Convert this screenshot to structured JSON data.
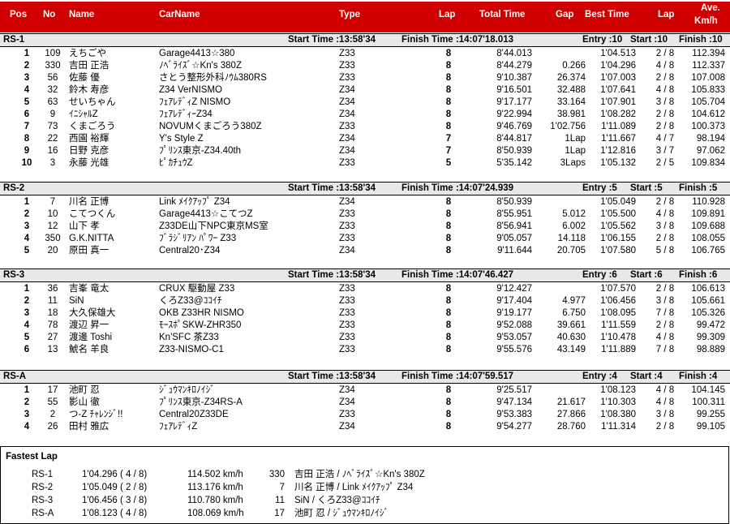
{
  "header": {
    "pos": "Pos",
    "no": "No",
    "name": "Name",
    "carname": "CarName",
    "type": "Type",
    "lap": "Lap",
    "total_time": "Total Time",
    "gap": "Gap",
    "best_time": "Best Time",
    "best_lap": "Lap",
    "ave_1": "Ave.",
    "ave_2": "Km/h"
  },
  "classes": [
    {
      "name": "RS-1",
      "start": "Start Time :13:58'34",
      "finish": "Finish Time :14:07'18.013",
      "entry": "Entry :10",
      "started": "Start :10",
      "finished": "Finish :10",
      "rows": [
        [
          "1",
          "109",
          "えちごや",
          "Garage4413☆380",
          "Z33",
          "8",
          "8'44.013",
          "",
          "1'04.513",
          "2 / 8",
          "112.394"
        ],
        [
          "2",
          "330",
          "吉田 正浩",
          "ﾉﾍﾞﾗｲｽﾞ☆Kn's 380Z",
          "Z33",
          "8",
          "8'44.279",
          "0.266",
          "1'04.296",
          "4 / 8",
          "112.337"
        ],
        [
          "3",
          "56",
          "佐藤 優",
          "さとう整形外科ﾉｳﾑ380RS",
          "Z33",
          "8",
          "9'10.387",
          "26.374",
          "1'07.003",
          "2 / 8",
          "107.008"
        ],
        [
          "4",
          "32",
          "鈴木 寿彦",
          "Z34 VerNISMO",
          "Z34",
          "8",
          "9'16.501",
          "32.488",
          "1'07.641",
          "4 / 8",
          "105.833"
        ],
        [
          "5",
          "63",
          "せいちゃん",
          "ﾌｪｱﾚﾃﾞｨZ NISMO",
          "Z34",
          "8",
          "9'17.177",
          "33.164",
          "1'07.901",
          "3 / 8",
          "105.704"
        ],
        [
          "6",
          "9",
          "ｲﾆｼｬﾙZ",
          "ﾌｪｱﾚﾃﾞｨｰZ34",
          "Z34",
          "8",
          "9'22.994",
          "38.981",
          "1'08.282",
          "2 / 8",
          "104.612"
        ],
        [
          "7",
          "73",
          "くまごろう",
          "NOVUMくまごろう380Z",
          "Z33",
          "8",
          "9'46.769",
          "1'02.756",
          "1'11.089",
          "2 / 8",
          "100.373"
        ],
        [
          "8",
          "22",
          "西園 裕輝",
          "Y's Style Z",
          "Z34",
          "7",
          "8'44.817",
          "1Lap",
          "1'11.667",
          "4 / 7",
          "98.194"
        ],
        [
          "9",
          "16",
          "日野 克彦",
          "ﾌﾟﾘﾝｽ東京-Z34.40th",
          "Z34",
          "7",
          "8'50.939",
          "1Lap",
          "1'12.816",
          "3 / 7",
          "97.062"
        ],
        [
          "10",
          "3",
          "永藤 光雄",
          "ﾋﾟｶﾁｭｳZ",
          "Z33",
          "5",
          "5'35.142",
          "3Laps",
          "1'05.132",
          "2 / 5",
          "109.834"
        ]
      ]
    },
    {
      "name": "RS-2",
      "start": "Start Time :13:58'34",
      "finish": "Finish Time :14:07'24.939",
      "entry": "Entry :5",
      "started": "Start :5",
      "finished": "Finish :5",
      "rows": [
        [
          "1",
          "7",
          "川名 正博",
          "Link ﾒｲｸｱｯﾌﾟ Z34",
          "Z34",
          "8",
          "8'50.939",
          "",
          "1'05.049",
          "2 / 8",
          "110.928"
        ],
        [
          "2",
          "10",
          "こてつくん",
          "Garage4413☆こてつZ",
          "Z33",
          "8",
          "8'55.951",
          "5.012",
          "1'05.500",
          "4 / 8",
          "109.891"
        ],
        [
          "3",
          "12",
          "山下 孝",
          "Z33DE山下NPC東京MS室",
          "Z33",
          "8",
          "8'56.941",
          "6.002",
          "1'05.562",
          "3 / 8",
          "109.688"
        ],
        [
          "4",
          "350",
          "G.K.NITTA",
          "ﾌﾞﾗｼﾞﾘｱﾝ ﾊﾟﾜｰ Z33",
          "Z33",
          "8",
          "9'05.057",
          "14.118",
          "1'06.155",
          "2 / 8",
          "108.055"
        ],
        [
          "5",
          "20",
          "原田 真一",
          "Central20･Z34",
          "Z34",
          "8",
          "9'11.644",
          "20.705",
          "1'07.580",
          "5 / 8",
          "106.765"
        ]
      ]
    },
    {
      "name": "RS-3",
      "start": "Start Time :13:58'34",
      "finish": "Finish Time :14:07'46.427",
      "entry": "Entry :6",
      "started": "Start :6",
      "finished": "Finish :6",
      "rows": [
        [
          "1",
          "36",
          "吉峯 竜太",
          "CRUX 駆動屋 Z33",
          "Z33",
          "8",
          "9'12.427",
          "",
          "1'07.570",
          "2 / 8",
          "106.613"
        ],
        [
          "2",
          "11",
          "SiN",
          "くろZ33@ｺｺｲﾁ",
          "Z33",
          "8",
          "9'17.404",
          "4.977",
          "1'06.456",
          "3 / 8",
          "105.661"
        ],
        [
          "3",
          "18",
          "大久保雄大",
          "OKB Z33HR NISMO",
          "Z33",
          "8",
          "9'19.177",
          "6.750",
          "1'08.095",
          "7 / 8",
          "105.326"
        ],
        [
          "4",
          "78",
          "渡辺 昇一",
          "ﾓｰｽﾎﾟSKW-ZHR350",
          "Z33",
          "8",
          "9'52.088",
          "39.661",
          "1'11.559",
          "2 / 8",
          "99.472"
        ],
        [
          "5",
          "27",
          "渡邊 Toshi",
          "Kn'SFC 茶Z33",
          "Z33",
          "8",
          "9'53.057",
          "40.630",
          "1'10.478",
          "4 / 8",
          "99.309"
        ],
        [
          "6",
          "13",
          "鯱名 羊良",
          "Z33-NISMO-C1",
          "Z33",
          "8",
          "9'55.576",
          "43.149",
          "1'11.889",
          "7 / 8",
          "98.889"
        ]
      ]
    },
    {
      "name": "RS-A",
      "start": "Start Time :13:58'34",
      "finish": "Finish Time :14:07'59.517",
      "entry": "Entry :4",
      "started": "Start :4",
      "finished": "Finish :4",
      "rows": [
        [
          "1",
          "17",
          "池町 忍",
          "ｼﾞｭｳﾏﾝｷﾛﾉｲｼﾞ",
          "Z34",
          "8",
          "9'25.517",
          "",
          "1'08.123",
          "4 / 8",
          "104.145"
        ],
        [
          "2",
          "55",
          "影山 徹",
          "ﾌﾟﾘﾝｽ東京-Z34RS-A",
          "Z34",
          "8",
          "9'47.134",
          "21.617",
          "1'10.303",
          "4 / 8",
          "100.311"
        ],
        [
          "3",
          "2",
          "つ-Z ﾁｬﾚﾝｼﾞ!!",
          "Central20Z33DE",
          "Z33",
          "8",
          "9'53.383",
          "27.866",
          "1'08.380",
          "3 / 8",
          "99.255"
        ],
        [
          "4",
          "26",
          "田村 雅広",
          "ﾌｪｱﾚﾃﾞｨZ",
          "Z34",
          "8",
          "9'54.277",
          "28.760",
          "1'11.314",
          "2 / 8",
          "99.105"
        ]
      ]
    }
  ],
  "fastest_lap": {
    "title": "Fastest Lap",
    "rows": [
      [
        "RS-1",
        "1'04.296 ( 4 / 8)",
        "114.502 km/h",
        "330",
        "吉田 正浩 / ﾉﾍﾞﾗｲｽﾞ☆Kn's 380Z"
      ],
      [
        "RS-2",
        "1'05.049 ( 2 / 8)",
        "113.176 km/h",
        "7",
        "川名 正博 / Link ﾒｲｸｱｯﾌﾟ Z34"
      ],
      [
        "RS-3",
        "1'06.456 ( 3 / 8)",
        "110.780 km/h",
        "11",
        "SiN / くろZ33@ｺｺｲﾁ"
      ],
      [
        "RS-A",
        "1'08.123 ( 4 / 8)",
        "108.069 km/h",
        "17",
        "池町 忍 / ｼﾞｭｳﾏﾝｷﾛﾉｲｼﾞ"
      ]
    ]
  },
  "colors": {
    "header_bg": "#d00000",
    "header_text": "#ffffff",
    "class_bar_bg": "#e8e8e8"
  }
}
